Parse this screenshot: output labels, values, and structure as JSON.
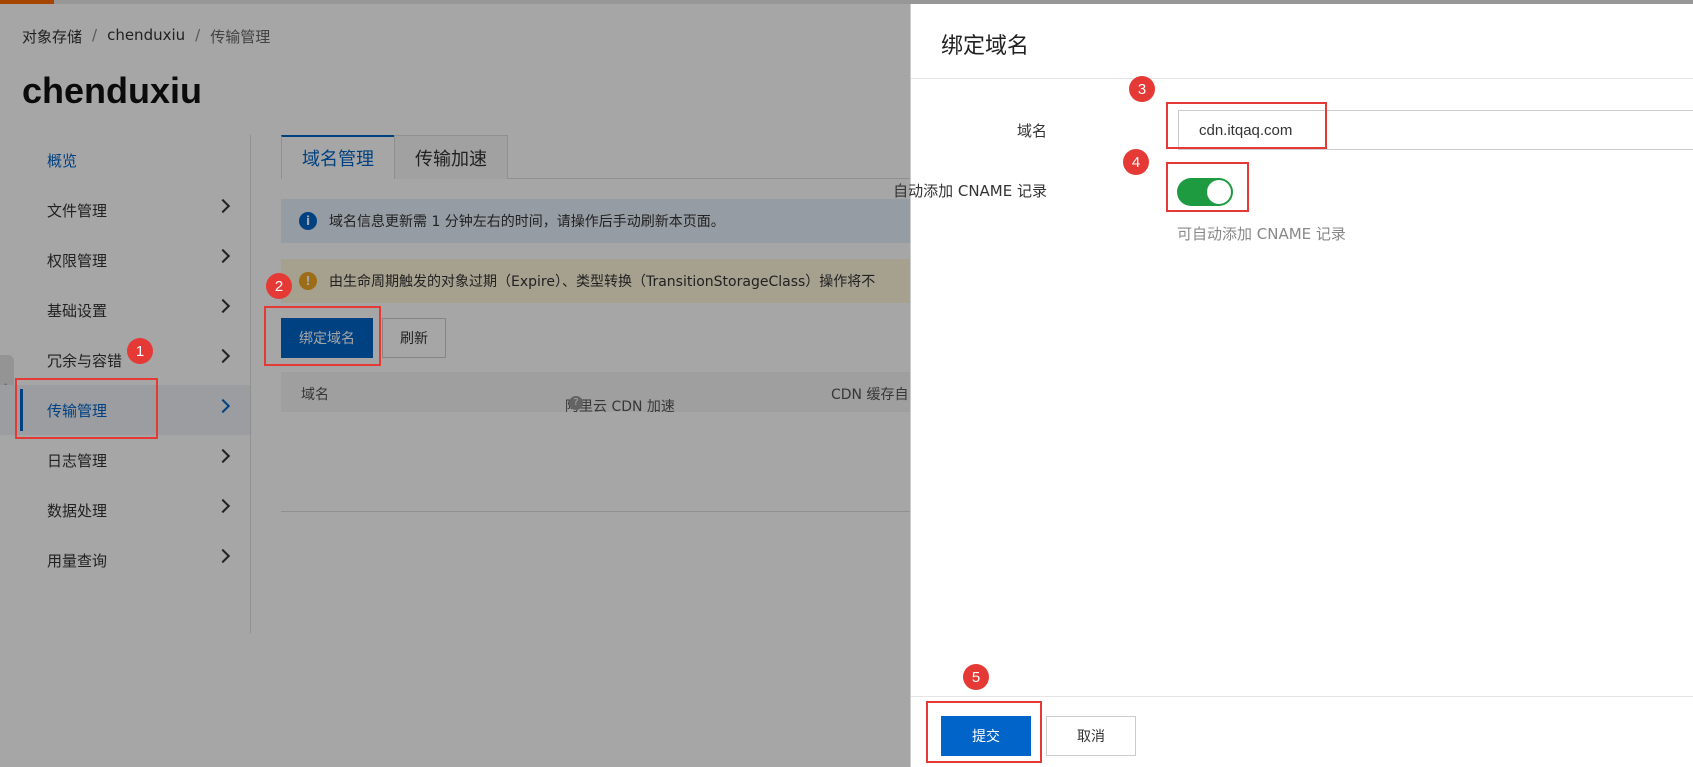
{
  "breadcrumb": {
    "root": "对象存储",
    "bucket": "chenduxiu",
    "current": "传输管理",
    "sep": "/"
  },
  "bucket_title": "chenduxiu",
  "sidebar": {
    "items": [
      {
        "label": "概览"
      },
      {
        "label": "文件管理"
      },
      {
        "label": "权限管理"
      },
      {
        "label": "基础设置"
      },
      {
        "label": "冗余与容错"
      },
      {
        "label": "传输管理"
      },
      {
        "label": "日志管理"
      },
      {
        "label": "数据处理"
      },
      {
        "label": "用量查询"
      }
    ],
    "active": "传输管理"
  },
  "tabs": {
    "domain": "域名管理",
    "accel": "传输加速"
  },
  "notices": {
    "info_icon": "i",
    "info": "域名信息更新需 1 分钟左右的时间，请操作后手动刷新本页面。",
    "warn_icon": "!",
    "warn": "由生命周期触发的对象过期（Expire）、类型转换（TransitionStorageClass）操作将不"
  },
  "toolbar": {
    "bind": "绑定域名",
    "refresh": "刷新"
  },
  "table": {
    "col_domain": "域名",
    "col_cdn": "阿里云 CDN 加速",
    "col_cdn_help": "?",
    "col_cache": "CDN 缓存自"
  },
  "drawer": {
    "title": "绑定域名",
    "domain_label": "域名",
    "domain_value": "cdn.itqaq.com",
    "cname_label": "自动添加 CNAME 记录",
    "cname_on": true,
    "cname_help": "可自动添加 CNAME 记录",
    "submit": "提交",
    "cancel": "取消"
  },
  "annotations": [
    "1",
    "2",
    "3",
    "4",
    "5"
  ],
  "colors": {
    "primary": "#0064c8",
    "toggle_on": "#1e9a41",
    "annotation": "#e53935",
    "brand": "#ff6a00"
  }
}
